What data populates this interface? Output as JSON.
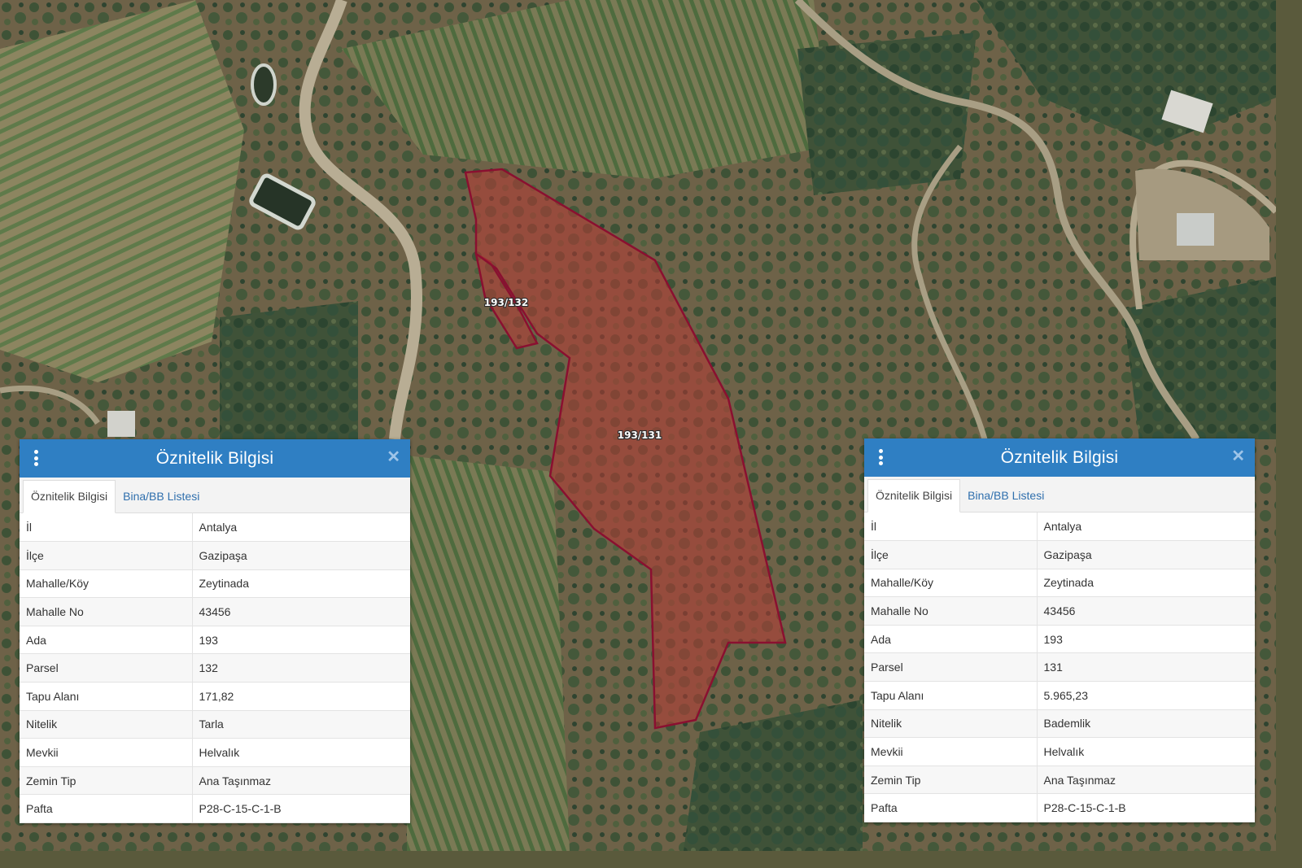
{
  "map": {
    "parcel_labels": {
      "small": "193/132",
      "large": "193/131"
    },
    "colors": {
      "parcel_outline": "#8a1030",
      "parcel_fill": "#c0312d"
    }
  },
  "panels": [
    {
      "title": "Öznitelik Bilgisi",
      "tabs": [
        "Öznitelik Bilgisi",
        "Bina/BB Listesi"
      ],
      "rows": [
        {
          "key": "İl",
          "value": "Antalya"
        },
        {
          "key": "İlçe",
          "value": "Gazipaşa"
        },
        {
          "key": "Mahalle/Köy",
          "value": "Zeytinada"
        },
        {
          "key": "Mahalle No",
          "value": "43456"
        },
        {
          "key": "Ada",
          "value": "193"
        },
        {
          "key": "Parsel",
          "value": "132"
        },
        {
          "key": "Tapu Alanı",
          "value": "171,82"
        },
        {
          "key": "Nitelik",
          "value": "Tarla"
        },
        {
          "key": "Mevkii",
          "value": "Helvalık"
        },
        {
          "key": "Zemin Tip",
          "value": "Ana Taşınmaz"
        },
        {
          "key": "Pafta",
          "value": "P28-C-15-C-1-B"
        }
      ]
    },
    {
      "title": "Öznitelik Bilgisi",
      "tabs": [
        "Öznitelik Bilgisi",
        "Bina/BB Listesi"
      ],
      "rows": [
        {
          "key": "İl",
          "value": "Antalya"
        },
        {
          "key": "İlçe",
          "value": "Gazipaşa"
        },
        {
          "key": "Mahalle/Köy",
          "value": "Zeytinada"
        },
        {
          "key": "Mahalle No",
          "value": "43456"
        },
        {
          "key": "Ada",
          "value": "193"
        },
        {
          "key": "Parsel",
          "value": "131"
        },
        {
          "key": "Tapu Alanı",
          "value": "5.965,23"
        },
        {
          "key": "Nitelik",
          "value": "Bademlik"
        },
        {
          "key": "Mevkii",
          "value": "Helvalık"
        },
        {
          "key": "Zemin Tip",
          "value": "Ana Taşınmaz"
        },
        {
          "key": "Pafta",
          "value": "P28-C-15-C-1-B"
        }
      ]
    }
  ]
}
